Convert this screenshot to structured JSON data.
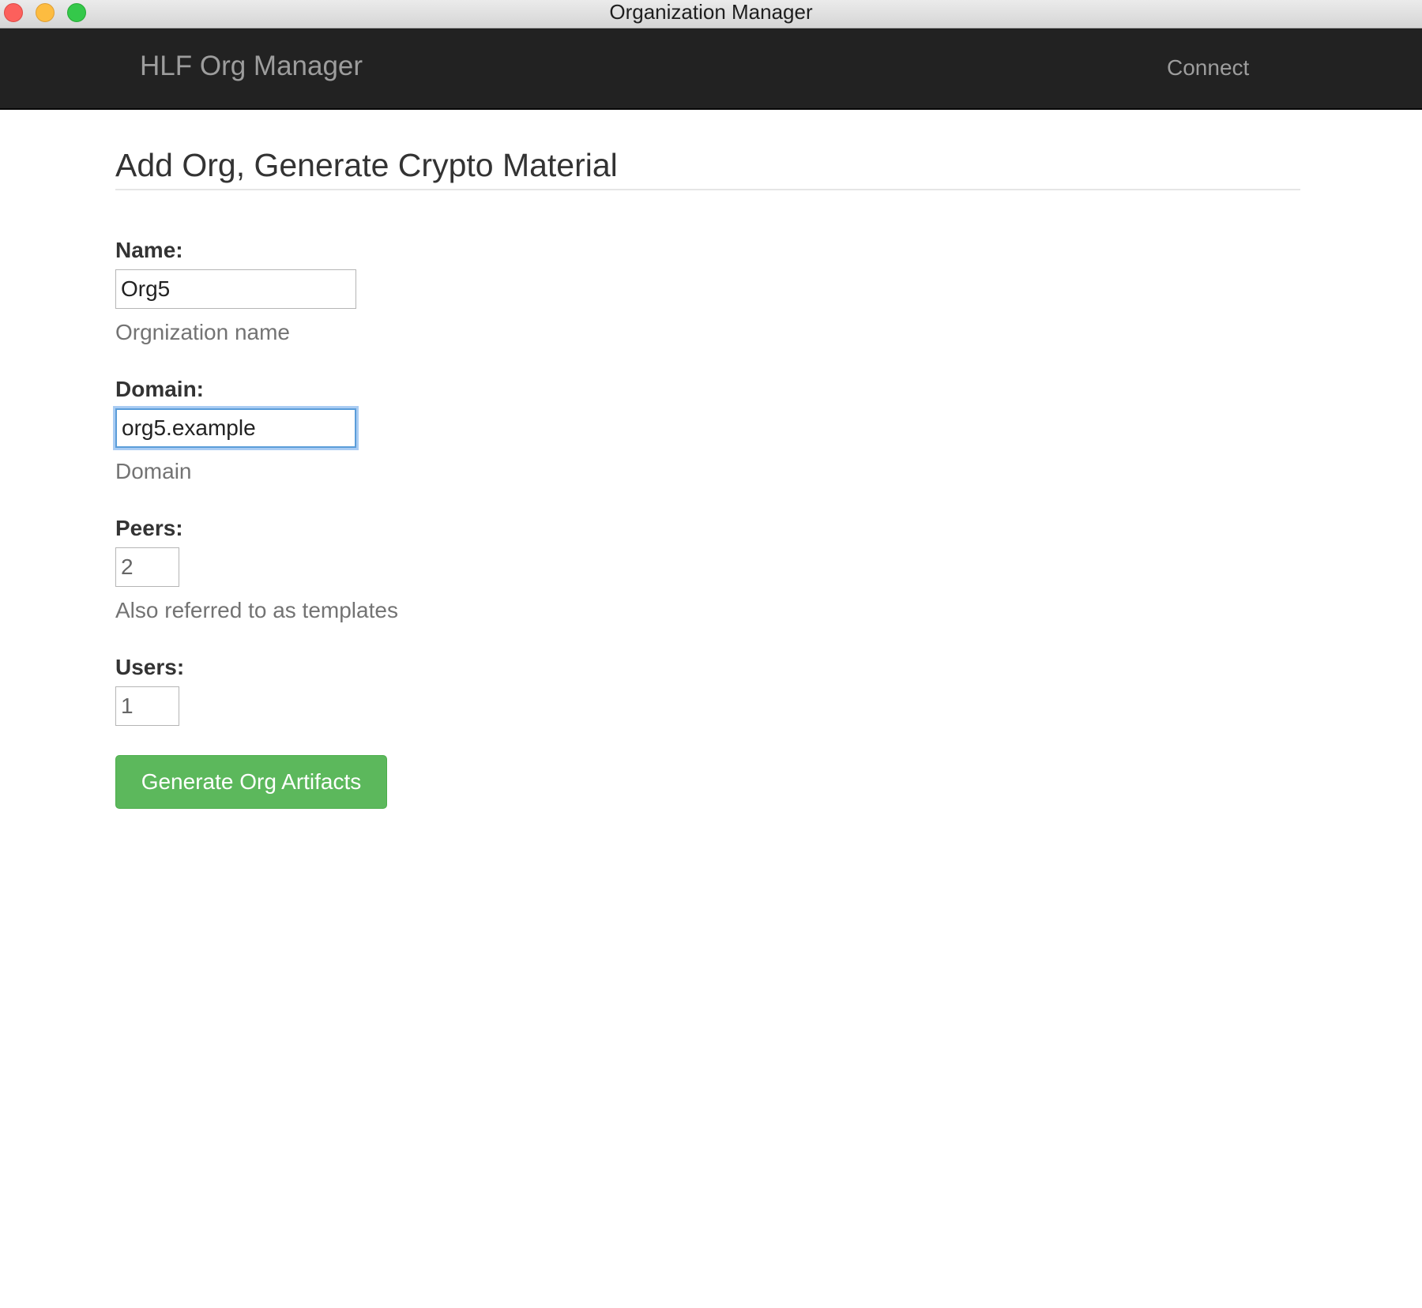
{
  "window": {
    "title": "Organization Manager"
  },
  "navbar": {
    "brand": "HLF Org Manager",
    "connect_label": "Connect"
  },
  "page": {
    "title": "Add Org, Generate Crypto Material"
  },
  "form": {
    "name": {
      "label": "Name:",
      "value": "Org5",
      "help": "Orgnization name"
    },
    "domain": {
      "label": "Domain:",
      "value": "org5.example",
      "help": "Domain"
    },
    "peers": {
      "label": "Peers:",
      "value": "2",
      "help": "Also referred to as templates"
    },
    "users": {
      "label": "Users:",
      "value": "1"
    },
    "submit_label": "Generate Org Artifacts"
  },
  "colors": {
    "navbar_bg": "#222222",
    "navbar_text": "#9d9d9d",
    "button_green": "#5cb85c",
    "focus_ring": "#5b9dd9"
  }
}
